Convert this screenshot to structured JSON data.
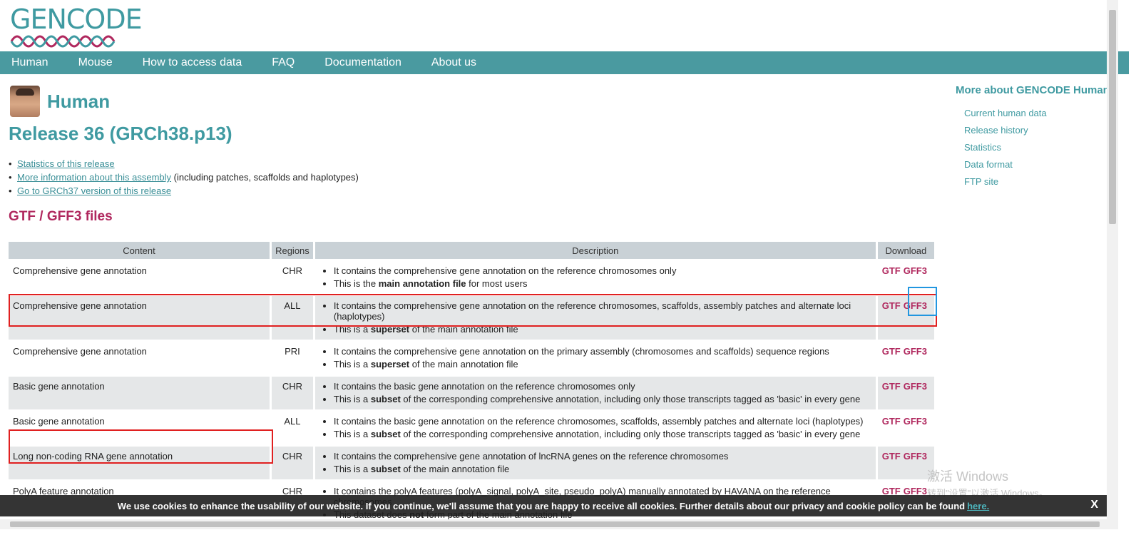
{
  "logo": {
    "text": "GENCODE"
  },
  "nav": [
    "Human",
    "Mouse",
    "How to access data",
    "FAQ",
    "Documentation",
    "About us"
  ],
  "page_title": "Human",
  "release": "Release 36 (GRCh38.p13)",
  "links": [
    {
      "link": "Statistics of this release",
      "suffix": ""
    },
    {
      "link": "More information about this assembly",
      "suffix": " (including patches, scaffolds and haplotypes)"
    },
    {
      "link": "Go to GRCh37 version of this release",
      "suffix": ""
    }
  ],
  "section_title": "GTF / GFF3 files",
  "table": {
    "headers": [
      "Content",
      "Regions",
      "Description",
      "Download"
    ],
    "rows": [
      {
        "content": "Comprehensive gene annotation",
        "regions": "CHR",
        "d1": "It contains the comprehensive gene annotation on the reference chromosomes only",
        "d2_pre": "This is the ",
        "d2_bold": "main annotation file",
        "d2_post": " for most users"
      },
      {
        "content": "Comprehensive gene annotation",
        "regions": "ALL",
        "d1": "It contains the comprehensive gene annotation on the reference chromosomes, scaffolds, assembly patches and alternate loci (haplotypes)",
        "d2_pre": "This is a ",
        "d2_bold": "superset",
        "d2_post": " of the main annotation file"
      },
      {
        "content": "Comprehensive gene annotation",
        "regions": "PRI",
        "d1": "It contains the comprehensive gene annotation on the primary assembly (chromosomes and scaffolds) sequence regions",
        "d2_pre": "This is a ",
        "d2_bold": "superset",
        "d2_post": " of the main annotation file"
      },
      {
        "content": "Basic gene annotation",
        "regions": "CHR",
        "d1": "It contains the basic gene annotation on the reference chromosomes only",
        "d2_pre": "This is a ",
        "d2_bold": "subset",
        "d2_post": " of the corresponding comprehensive annotation, including only those transcripts tagged as 'basic' in every gene"
      },
      {
        "content": "Basic gene annotation",
        "regions": "ALL",
        "d1": "It contains the basic gene annotation on the reference chromosomes, scaffolds, assembly patches and alternate loci (haplotypes)",
        "d2_pre": "This is a ",
        "d2_bold": "subset",
        "d2_post": " of the corresponding comprehensive annotation, including only those transcripts tagged as 'basic' in every gene"
      },
      {
        "content": "Long non-coding RNA gene annotation",
        "regions": "CHR",
        "d1": "It contains the comprehensive gene annotation of lncRNA genes on the reference chromosomes",
        "d2_pre": "This is a ",
        "d2_bold": "subset",
        "d2_post": " of the main annotation file"
      },
      {
        "content": "PolyA feature annotation",
        "regions": "CHR",
        "d1": "It contains the polyA features (polyA_signal, polyA_site, pseudo_polyA) manually annotated by HAVANA on the reference chromosomes",
        "d2_pre": "This dataset does ",
        "d2_bold": "not",
        "d2_post": " form part of the main annotation file"
      }
    ],
    "gtf": "GTF",
    "gff3": "GFF3"
  },
  "sidebar": {
    "title": "More about GENCODE Human",
    "links": [
      "Current human data",
      "Release history",
      "Statistics",
      "Data format",
      "FTP site"
    ]
  },
  "watermark": {
    "line1": "激活 Windows",
    "line2": "转到\"设置\"以激活 Windows。"
  },
  "cookie": {
    "text": "We use cookies to enhance the usability of our website. If you continue, we'll assume that you are happy to receive all cookies. Further details about our privacy and cookie policy can be found",
    "link": "here.",
    "close": "X"
  },
  "colors": {
    "teal": "#4a9aa0",
    "magenta": "#b0285e",
    "highlight_red": "#e02020",
    "highlight_blue": "#2196e0"
  }
}
